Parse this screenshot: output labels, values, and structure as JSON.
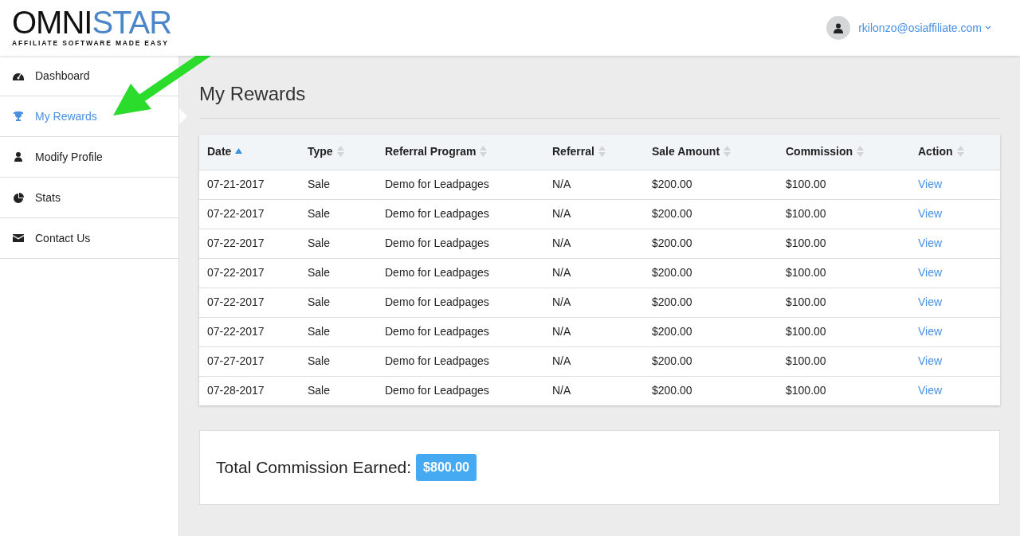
{
  "logo": {
    "name_dark": "OMNI",
    "name_accent": "STAR",
    "tagline": "AFFILIATE SOFTWARE MADE EASY"
  },
  "user": {
    "email": "rkilonzo@osiaffiliate.com"
  },
  "sidebar": {
    "items": [
      {
        "label": "Dashboard",
        "selected": false
      },
      {
        "label": "My Rewards",
        "selected": true
      },
      {
        "label": "Modify Profile",
        "selected": false
      },
      {
        "label": "Stats",
        "selected": false
      },
      {
        "label": "Contact Us",
        "selected": false
      }
    ]
  },
  "page_title": "My Rewards",
  "table": {
    "columns": [
      {
        "label": "Date",
        "sorted": true
      },
      {
        "label": "Type",
        "sorted": false
      },
      {
        "label": "Referral Program",
        "sorted": false
      },
      {
        "label": "Referral",
        "sorted": false
      },
      {
        "label": "Sale Amount",
        "sorted": false
      },
      {
        "label": "Commission",
        "sorted": false
      },
      {
        "label": "Action",
        "sorted": false
      }
    ],
    "rows": [
      [
        "07-21-2017",
        "Sale",
        "Demo for Leadpages",
        "N/A",
        "$200.00",
        "$100.00",
        "View"
      ],
      [
        "07-22-2017",
        "Sale",
        "Demo for Leadpages",
        "N/A",
        "$200.00",
        "$100.00",
        "View"
      ],
      [
        "07-22-2017",
        "Sale",
        "Demo for Leadpages",
        "N/A",
        "$200.00",
        "$100.00",
        "View"
      ],
      [
        "07-22-2017",
        "Sale",
        "Demo for Leadpages",
        "N/A",
        "$200.00",
        "$100.00",
        "View"
      ],
      [
        "07-22-2017",
        "Sale",
        "Demo for Leadpages",
        "N/A",
        "$200.00",
        "$100.00",
        "View"
      ],
      [
        "07-22-2017",
        "Sale",
        "Demo for Leadpages",
        "N/A",
        "$200.00",
        "$100.00",
        "View"
      ],
      [
        "07-27-2017",
        "Sale",
        "Demo for Leadpages",
        "N/A",
        "$200.00",
        "$100.00",
        "View"
      ],
      [
        "07-28-2017",
        "Sale",
        "Demo for Leadpages",
        "N/A",
        "$200.00",
        "$100.00",
        "View"
      ]
    ]
  },
  "total": {
    "label": "Total Commission Earned:",
    "amount": "$800.00"
  }
}
